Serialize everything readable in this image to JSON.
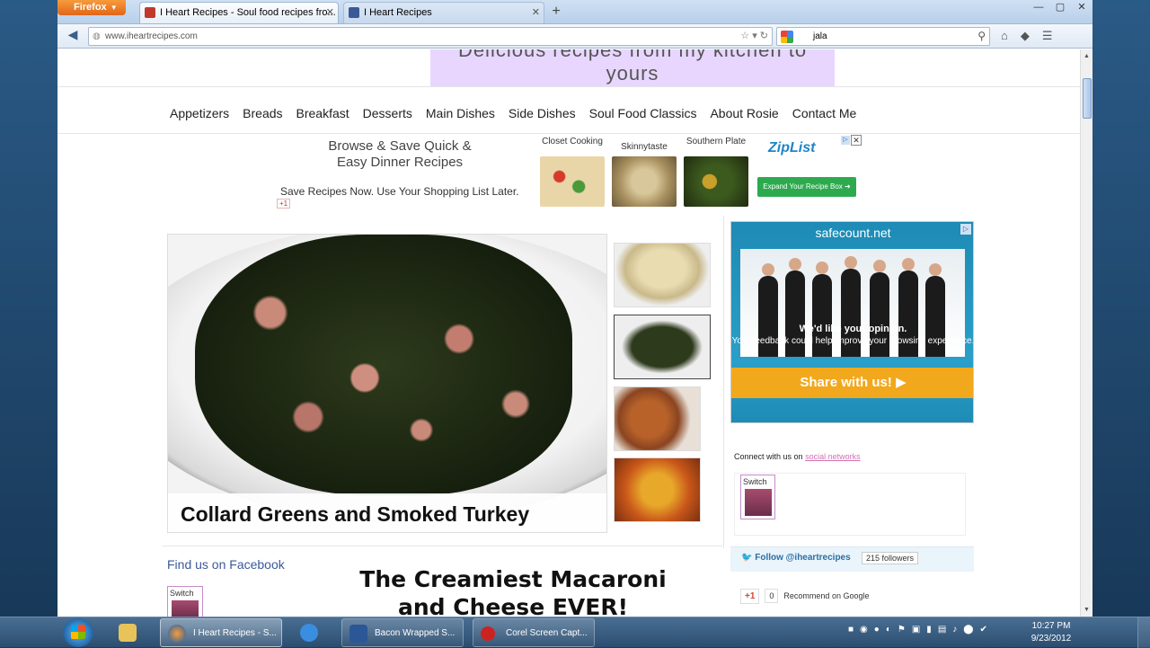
{
  "browser": {
    "app_button": "Firefox",
    "tabs": [
      {
        "title": "I Heart Recipes - Soul food recipes fro...",
        "active": true
      },
      {
        "title": "I Heart Recipes",
        "active": false
      }
    ],
    "url": "www.iheartrecipes.com",
    "search_query": "jala"
  },
  "site": {
    "tagline": "Delicious recipes from my kitchen to yours",
    "menu": [
      "Appetizers",
      "Breads",
      "Breakfast",
      "Desserts",
      "Main Dishes",
      "Side Dishes",
      "Soul Food Classics",
      "About Rosie",
      "Contact Me"
    ],
    "top_ad": {
      "headline": "Browse & Save Quick & Easy Dinner Recipes",
      "sub": "Save Recipes Now. Use Your Shopping List Later.",
      "thumbs": [
        "Closet Cooking",
        "Skinnytaste",
        "Southern Plate"
      ],
      "brand": "ZipList",
      "button": "Expand Your Recipe Box ➜",
      "gplus": "+1"
    },
    "featured": {
      "caption": "Collard Greens and Smoked Turkey"
    },
    "side_ad": {
      "site": "safecount.net",
      "opinion_title": "We'd like your opinion.",
      "opinion_text": "Your feedback could help improve your browsing experience.",
      "share": "Share with us!"
    },
    "connect": {
      "prefix": "Connect with us on",
      "link": "social networks",
      "switch_label": "Switch"
    },
    "twitter": {
      "button": "Follow @iheartrecipes",
      "count": "215 followers"
    },
    "google": {
      "button": "+1",
      "count": "0",
      "label": "Recommend on Google"
    },
    "facebook": {
      "title": "Find us on Facebook",
      "switch_label": "Switch"
    },
    "post_title": "The Creamiest Macaroni and Cheese EVER!"
  },
  "taskbar": {
    "items": [
      {
        "label": "I Heart Recipes - S..."
      },
      {
        "label": "Bacon Wrapped S..."
      },
      {
        "label": "Corel Screen Capt..."
      }
    ],
    "time": "10:27 PM",
    "date": "9/23/2012"
  },
  "colors": {
    "accent_purple": "#e8d6ff",
    "facebook_blue": "#3b5998",
    "share_orange": "#f2a81d",
    "ziplist_green": "#2daa4e"
  }
}
